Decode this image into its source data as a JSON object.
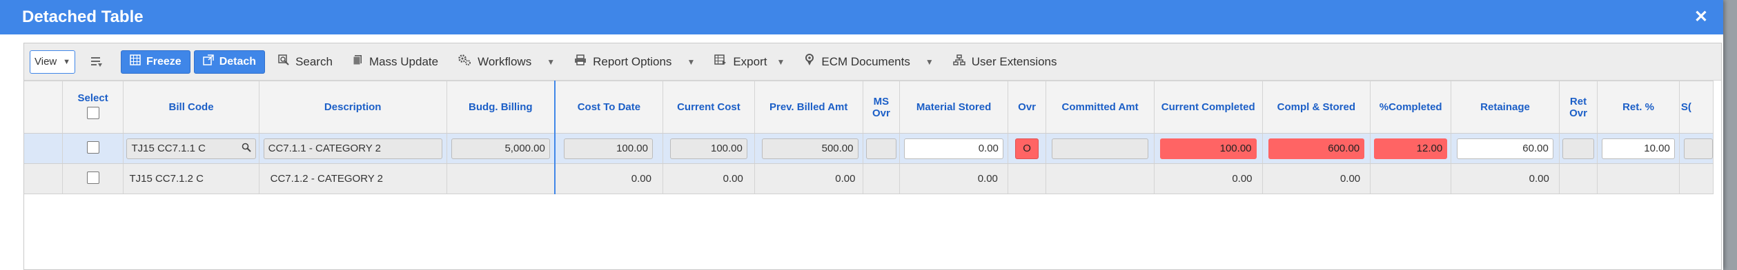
{
  "window": {
    "title": "Detached Table",
    "close_glyph": "✕"
  },
  "toolbar": {
    "view_label": "View",
    "freeze_label": "Freeze",
    "detach_label": "Detach",
    "search_label": "Search",
    "mass_update_label": "Mass Update",
    "workflows_label": "Workflows",
    "report_options_label": "Report Options",
    "export_label": "Export",
    "ecm_documents_label": "ECM Documents",
    "user_extensions_label": "User Extensions"
  },
  "columns": {
    "select": "Select",
    "bill_code": "Bill Code",
    "description": "Description",
    "budg_billing": "Budg. Billing",
    "cost_to_date": "Cost To Date",
    "current_cost": "Current Cost",
    "prev_billed_amt": "Prev. Billed Amt",
    "ms_ovr": "MS Ovr",
    "material_stored": "Material Stored",
    "ovr": "Ovr",
    "committed_amt": "Committed Amt",
    "current_completed": "Current Completed",
    "compl_stored": "Compl & Stored",
    "pct_completed": "%Completed",
    "retainage": "Retainage",
    "ret_ovr": "Ret Ovr",
    "ret_pct": "Ret. %",
    "s_partial": "S("
  },
  "rows": [
    {
      "bill_code": "TJ15  CC7.1.1  C",
      "description": "CC7.1.1 - CATEGORY 2",
      "budg_billing": "5,000.00",
      "cost_to_date": "100.00",
      "current_cost": "100.00",
      "prev_billed_amt": "500.00",
      "material_stored": "0.00",
      "ovr": "O",
      "current_completed": "100.00",
      "compl_stored": "600.00",
      "pct_completed": "12.00",
      "retainage": "60.00",
      "ret_pct": "10.00"
    },
    {
      "bill_code": "TJ15  CC7.1.2  C",
      "description": "CC7.1.2 - CATEGORY 2",
      "cost_to_date": "0.00",
      "current_cost": "0.00",
      "prev_billed_amt": "0.00",
      "material_stored": "0.00",
      "current_completed": "0.00",
      "compl_stored": "0.00",
      "retainage": "0.00"
    }
  ],
  "colors": {
    "accent": "#3f86e8",
    "highlight_red": "#ff6464",
    "selected_row": "#dbe7f8"
  }
}
